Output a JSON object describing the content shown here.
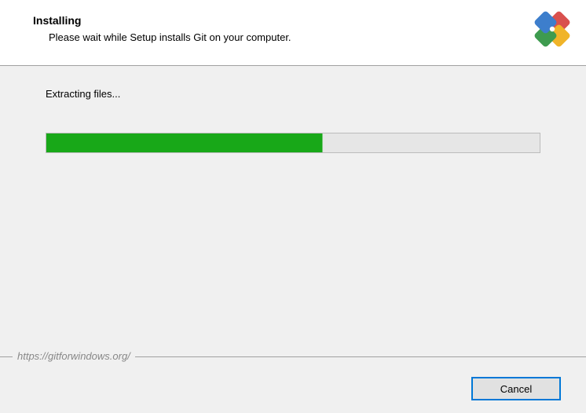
{
  "header": {
    "title": "Installing",
    "subtitle": "Please wait while Setup installs Git on your computer."
  },
  "body": {
    "status": "Extracting files...",
    "progress_percent": 56
  },
  "footer": {
    "url": "https://gitforwindows.org/",
    "cancel_label": "Cancel"
  },
  "logo": {
    "colors": {
      "top": "#d9514e",
      "right": "#f0b429",
      "bottom": "#3e9b4f",
      "left": "#3d7ecc"
    }
  }
}
